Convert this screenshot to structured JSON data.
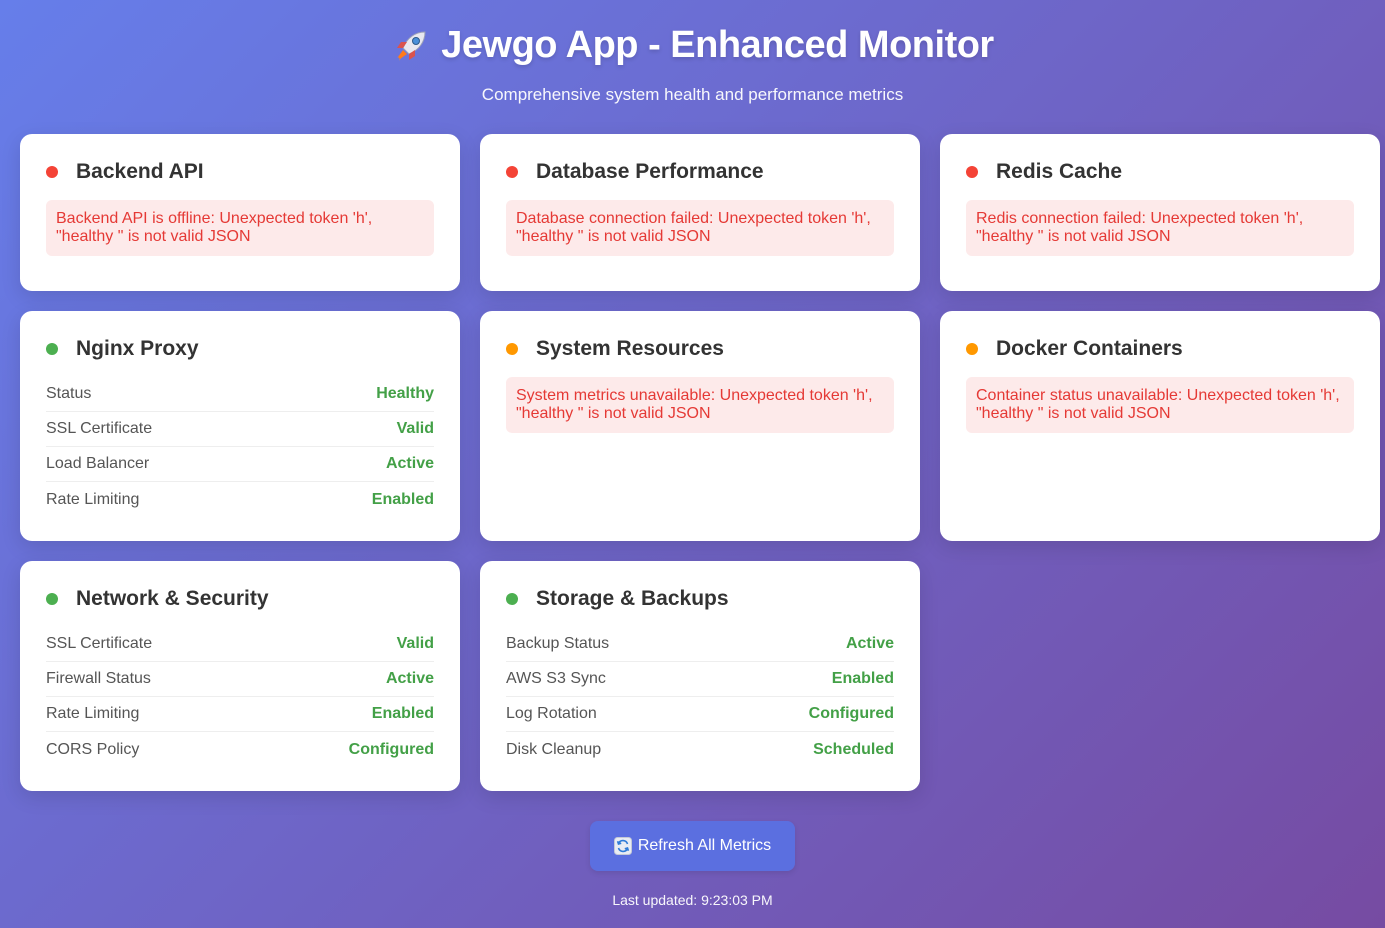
{
  "header": {
    "title": "Jewgo App - Enhanced Monitor",
    "title_icon": "rocket-icon",
    "subtitle": "Comprehensive system health and performance metrics"
  },
  "colors": {
    "error": "#f44336",
    "warning": "#ff9800",
    "healthy": "#4caf50",
    "error_text": "#e53935",
    "error_bg": "#fdeaea",
    "value_green": "#43a047"
  },
  "cards": [
    {
      "title": "Backend API",
      "status": "error",
      "error": "Backend API is offline: Unexpected token 'h', \"healthy \" is not valid JSON"
    },
    {
      "title": "Database Performance",
      "status": "error",
      "error": "Database connection failed: Unexpected token 'h', \"healthy \" is not valid JSON"
    },
    {
      "title": "Redis Cache",
      "status": "error",
      "error": "Redis connection failed: Unexpected token 'h', \"healthy \" is not valid JSON"
    },
    {
      "title": "Nginx Proxy",
      "status": "healthy",
      "metrics": [
        {
          "label": "Status",
          "value": "Healthy"
        },
        {
          "label": "SSL Certificate",
          "value": "Valid"
        },
        {
          "label": "Load Balancer",
          "value": "Active"
        },
        {
          "label": "Rate Limiting",
          "value": "Enabled"
        }
      ]
    },
    {
      "title": "System Resources",
      "status": "warning",
      "error": "System metrics unavailable: Unexpected token 'h', \"healthy \" is not valid JSON"
    },
    {
      "title": "Docker Containers",
      "status": "warning",
      "error": "Container status unavailable: Unexpected token 'h', \"healthy \" is not valid JSON"
    },
    {
      "title": "Network & Security",
      "status": "healthy",
      "metrics": [
        {
          "label": "SSL Certificate",
          "value": "Valid"
        },
        {
          "label": "Firewall Status",
          "value": "Active"
        },
        {
          "label": "Rate Limiting",
          "value": "Enabled"
        },
        {
          "label": "CORS Policy",
          "value": "Configured"
        }
      ]
    },
    {
      "title": "Storage & Backups",
      "status": "healthy",
      "metrics": [
        {
          "label": "Backup Status",
          "value": "Active"
        },
        {
          "label": "AWS S3 Sync",
          "value": "Enabled"
        },
        {
          "label": "Log Rotation",
          "value": "Configured"
        },
        {
          "label": "Disk Cleanup",
          "value": "Scheduled"
        }
      ]
    }
  ],
  "footer": {
    "refresh_label": "Refresh All Metrics",
    "refresh_icon": "refresh-icon",
    "last_updated": "Last updated: 9:23:03 PM"
  }
}
